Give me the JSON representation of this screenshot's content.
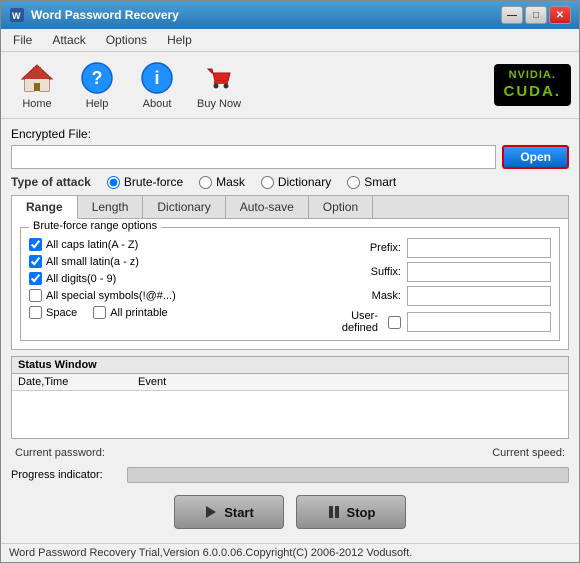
{
  "window": {
    "title": "Word Password Recovery",
    "controls": {
      "minimize": "—",
      "maximize": "□",
      "close": "✕"
    }
  },
  "menu": {
    "items": [
      "File",
      "Attack",
      "Options",
      "Help"
    ]
  },
  "toolbar": {
    "buttons": [
      {
        "id": "home",
        "label": "Home"
      },
      {
        "id": "help",
        "label": "Help"
      },
      {
        "id": "about",
        "label": "About"
      },
      {
        "id": "buynow",
        "label": "Buy Now"
      }
    ],
    "cuda_line1": "NVIDIA.",
    "cuda_line2": "CUDA."
  },
  "encrypted_file": {
    "label": "Encrypted File:",
    "value": "",
    "placeholder": "",
    "open_button": "Open"
  },
  "attack_type": {
    "label": "Type of attack",
    "options": [
      {
        "id": "brute",
        "label": "Brute-force",
        "checked": true
      },
      {
        "id": "mask",
        "label": "Mask",
        "checked": false
      },
      {
        "id": "dictionary",
        "label": "Dictionary",
        "checked": false
      },
      {
        "id": "smart",
        "label": "Smart",
        "checked": false
      }
    ]
  },
  "tabs": {
    "items": [
      "Range",
      "Length",
      "Dictionary",
      "Auto-save",
      "Option"
    ],
    "active": 0
  },
  "brute_force": {
    "group_title": "Brute-force range options",
    "checkboxes": [
      {
        "id": "caps",
        "label": "All caps latin(A - Z)",
        "checked": true
      },
      {
        "id": "small",
        "label": "All small latin(a - z)",
        "checked": true
      },
      {
        "id": "digits",
        "label": "All digits(0 - 9)",
        "checked": true
      },
      {
        "id": "special",
        "label": "All special symbols(!@#...)",
        "checked": false
      },
      {
        "id": "space",
        "label": "Space",
        "checked": false
      },
      {
        "id": "printable",
        "label": "All printable",
        "checked": false
      }
    ],
    "fields": [
      {
        "id": "prefix",
        "label": "Prefix:",
        "value": ""
      },
      {
        "id": "suffix",
        "label": "Suffix:",
        "value": ""
      },
      {
        "id": "mask",
        "label": "Mask:",
        "value": ""
      },
      {
        "id": "user_defined",
        "label": "User-defined",
        "value": "",
        "has_checkbox": true
      }
    ]
  },
  "status_window": {
    "title": "Status Window",
    "columns": [
      "Date,Time",
      "Event"
    ],
    "rows": []
  },
  "bottom": {
    "current_password_label": "Current password:",
    "current_password_value": "",
    "current_speed_label": "Current speed:",
    "current_speed_value": "",
    "progress_label": "Progress indicator:",
    "progress_value": 0
  },
  "action_buttons": {
    "start": "Start",
    "stop": "Stop"
  },
  "status_bar": {
    "text": "Word Password Recovery Trial,Version 6.0.0.06.Copyright(C) 2006-2012 Vodusoft."
  }
}
